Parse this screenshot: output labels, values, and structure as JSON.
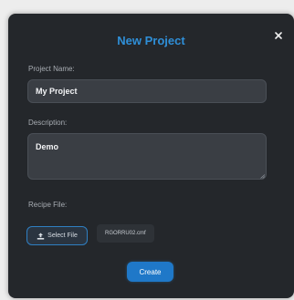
{
  "dialog": {
    "title": "New Project",
    "close_icon": "close-icon"
  },
  "form": {
    "project_name": {
      "label": "Project Name:",
      "value": "My Project"
    },
    "description": {
      "label": "Description:",
      "value": "Demo"
    },
    "recipe_file": {
      "label": "Recipe File:",
      "select_label": "Select File",
      "select_icon": "upload-icon",
      "file_name": "RGORRU02.cmf"
    }
  },
  "actions": {
    "create_label": "Create"
  },
  "colors": {
    "accent": "#2f8fd8",
    "modal_bg": "#24272b",
    "input_bg": "#3a3e44",
    "primary_button": "#1f78c8"
  }
}
